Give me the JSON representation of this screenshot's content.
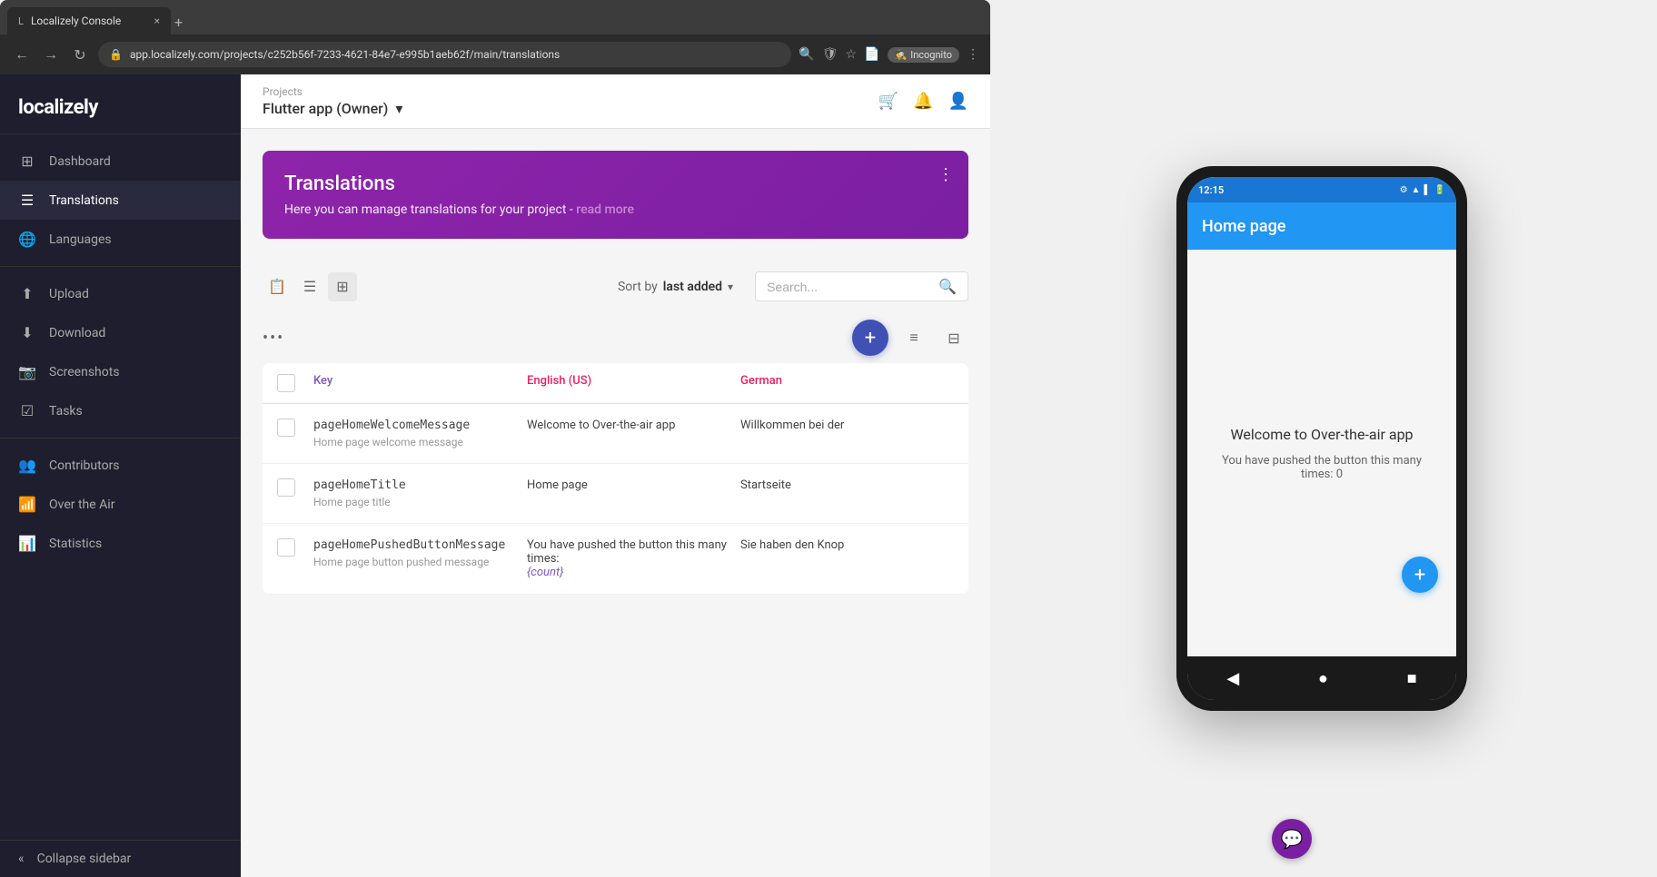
{
  "browser": {
    "tab_title": "Localizely Console",
    "tab_close": "×",
    "tab_new": "+",
    "address": "app.localizely.com/projects/c252b56f-7233-4621-84e7-e995b1aeb62f/main/translations",
    "incognito_label": "Incognito"
  },
  "topbar": {
    "projects_label": "Projects",
    "project_name": "Flutter app (Owner)",
    "dropdown_arrow": "▾"
  },
  "sidebar": {
    "logo": "localize",
    "logo_bold": "ly",
    "items": [
      {
        "id": "dashboard",
        "label": "Dashboard",
        "icon": "⊞"
      },
      {
        "id": "translations",
        "label": "Translations",
        "icon": "☰"
      },
      {
        "id": "languages",
        "label": "Languages",
        "icon": "🌐"
      },
      {
        "id": "upload",
        "label": "Upload",
        "icon": "↑"
      },
      {
        "id": "download",
        "label": "Download",
        "icon": "↓"
      },
      {
        "id": "screenshots",
        "label": "Screenshots",
        "icon": "📷"
      },
      {
        "id": "tasks",
        "label": "Tasks",
        "icon": "☑"
      },
      {
        "id": "contributors",
        "label": "Contributors",
        "icon": "👥"
      },
      {
        "id": "over-the-air",
        "label": "Over the Air",
        "icon": "📶"
      },
      {
        "id": "statistics",
        "label": "Statistics",
        "icon": "📊"
      }
    ],
    "collapse_label": "Collapse sidebar",
    "collapse_icon": "«"
  },
  "banner": {
    "title": "Translations",
    "description": "Here you can manage translations for your project - ",
    "read_more": "read more",
    "menu_icon": "⋮"
  },
  "toolbar": {
    "sort_label": "Sort by ",
    "sort_value": "last added",
    "sort_arrow": "▾",
    "search_placeholder": "Search...",
    "more_icon": "•••",
    "add_icon": "+",
    "filter_icon": "≡",
    "columns_icon": "⊞"
  },
  "table": {
    "columns": [
      "Key",
      "English (US)",
      "German"
    ],
    "rows": [
      {
        "key_name": "pageHomeWelcomeMessage",
        "key_desc": "Home page welcome message",
        "en_value": "Welcome to Over-the-air app",
        "de_value": "Willkommen bei der"
      },
      {
        "key_name": "pageHomeTitle",
        "key_desc": "Home page title",
        "en_value": "Home page",
        "de_value": "Startseite"
      },
      {
        "key_name": "pageHomePushedButtonMessage",
        "key_desc": "Home page button pushed message",
        "en_value": "You have pushed the button this many times:",
        "en_placeholder": "{count}",
        "de_value": "Sie haben den Knop"
      }
    ]
  },
  "phone": {
    "time": "12:15",
    "app_title": "Home page",
    "welcome_text": "Welcome to Over-the-air app",
    "counter_text": "You have pushed the button this many times: 0",
    "fab_icon": "+",
    "nav_back": "◀",
    "nav_home": "●",
    "nav_recent": "■"
  }
}
